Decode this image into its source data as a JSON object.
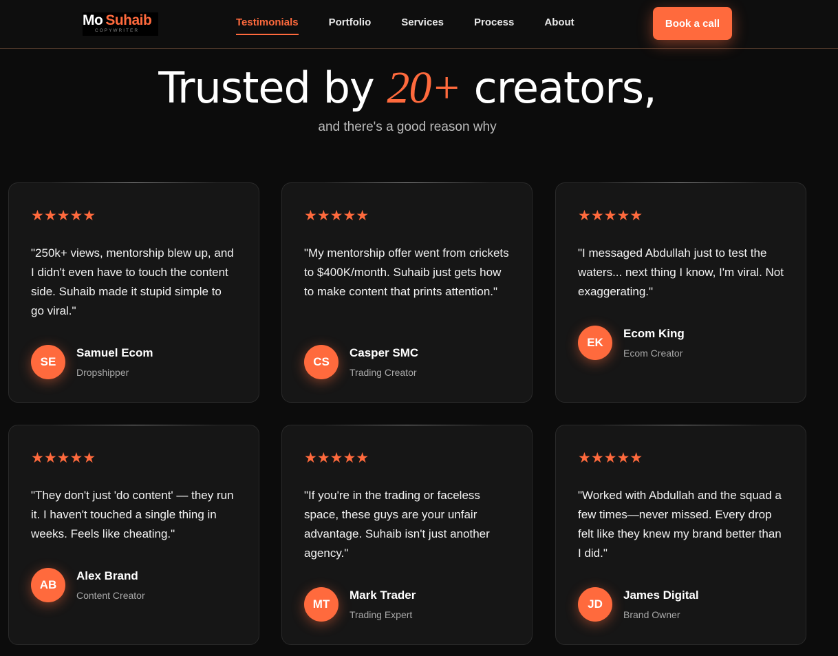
{
  "nav": {
    "logo": {
      "mo": "Mo",
      "name": "Suhaib",
      "tagline": "COPYWRITER"
    },
    "links": [
      "Testimonials",
      "Portfolio",
      "Services",
      "Process",
      "About"
    ],
    "active_link": "Testimonials",
    "cta_label": "Book a call"
  },
  "hero": {
    "title_before": "Trusted by ",
    "title_accent": "20+",
    "title_after": " creators,",
    "subtitle": "and there's a good reason why"
  },
  "colors": {
    "accent": "#ff6a3d",
    "background": "#0c0c0c",
    "card": "#161616"
  },
  "testimonials": [
    {
      "rating": 5,
      "stars": "★★★★★",
      "quote": "\"250k+ views, mentorship blew up, and I didn't even have to touch the content side. Suhaib made it stupid simple to go viral.\"",
      "initials": "SE",
      "name": "Samuel Ecom",
      "role": "Dropshipper"
    },
    {
      "rating": 5,
      "stars": "★★★★★",
      "quote": "\"My mentorship offer went from crickets to $400K/month. Suhaib just gets how to make content that prints attention.\"",
      "initials": "CS",
      "name": "Casper SMC",
      "role": "Trading Creator"
    },
    {
      "rating": 5,
      "stars": "★★★★★",
      "quote": "\"I messaged Abdullah just to test the waters... next thing I know, I'm viral. Not exaggerating.\"",
      "initials": "EK",
      "name": "Ecom King",
      "role": "Ecom Creator"
    },
    {
      "rating": 5,
      "stars": "★★★★★",
      "quote": "\"They don't just 'do content' — they run it. I haven't touched a single thing in weeks. Feels like cheating.\"",
      "initials": "AB",
      "name": "Alex Brand",
      "role": "Content Creator"
    },
    {
      "rating": 5,
      "stars": "★★★★★",
      "quote": "\"If you're in the trading or faceless space, these guys are your unfair advantage. Suhaib isn't just another agency.\"",
      "initials": "MT",
      "name": "Mark Trader",
      "role": "Trading Expert"
    },
    {
      "rating": 5,
      "stars": "★★★★★",
      "quote": "\"Worked with Abdullah and the squad a few times—never missed. Every drop felt like they knew my brand better than I did.\"",
      "initials": "JD",
      "name": "James Digital",
      "role": "Brand Owner"
    }
  ]
}
